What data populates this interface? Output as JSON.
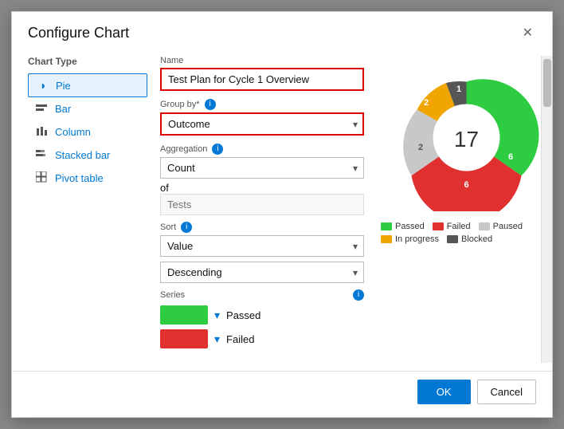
{
  "dialog": {
    "title": "Configure Chart",
    "close_label": "✕"
  },
  "left_panel": {
    "section_label": "Chart Type",
    "items": [
      {
        "id": "pie",
        "icon": "◑",
        "label": "Pie",
        "selected": true
      },
      {
        "id": "bar",
        "icon": "▬",
        "label": "Bar",
        "selected": false
      },
      {
        "id": "column",
        "icon": "▐",
        "label": "Column",
        "selected": false
      },
      {
        "id": "stacked_bar",
        "icon": "▤",
        "label": "Stacked bar",
        "selected": false
      },
      {
        "id": "pivot_table",
        "icon": "▦",
        "label": "Pivot table",
        "selected": false
      }
    ]
  },
  "mid_panel": {
    "name_label": "Name",
    "name_value": "Test Plan for Cycle 1 Overview",
    "group_by_label": "Group by*",
    "group_by_value": "Outcome",
    "aggregation_label": "Aggregation",
    "aggregation_value": "Count",
    "of_label": "of",
    "of_placeholder": "Tests",
    "sort_label": "Sort",
    "sort_value": "Value",
    "sort_order_value": "Descending",
    "series_label": "Series",
    "series_items": [
      {
        "color": "#2ecc40",
        "name": "Passed"
      },
      {
        "color": "#e03030",
        "name": "Failed"
      }
    ]
  },
  "chart": {
    "center_value": "17",
    "segments": [
      {
        "name": "Passed",
        "color": "#2ecc40",
        "value": 6,
        "label": "6"
      },
      {
        "name": "Failed",
        "color": "#e03030",
        "value": 6,
        "label": "6"
      },
      {
        "name": "Paused",
        "color": "#c8c8c8",
        "value": 2,
        "label": "2"
      },
      {
        "name": "In progress",
        "color": "#f0a500",
        "value": 2,
        "label": "2"
      },
      {
        "name": "Blocked",
        "color": "#555",
        "value": 1,
        "label": "1"
      }
    ],
    "legend": [
      {
        "label": "Passed",
        "color": "#2ecc40"
      },
      {
        "label": "Failed",
        "color": "#e03030"
      },
      {
        "label": "Paused",
        "color": "#c8c8c8"
      },
      {
        "label": "In progress",
        "color": "#f0a500"
      },
      {
        "label": "Blocked",
        "color": "#555"
      }
    ]
  },
  "footer": {
    "ok_label": "OK",
    "cancel_label": "Cancel"
  }
}
